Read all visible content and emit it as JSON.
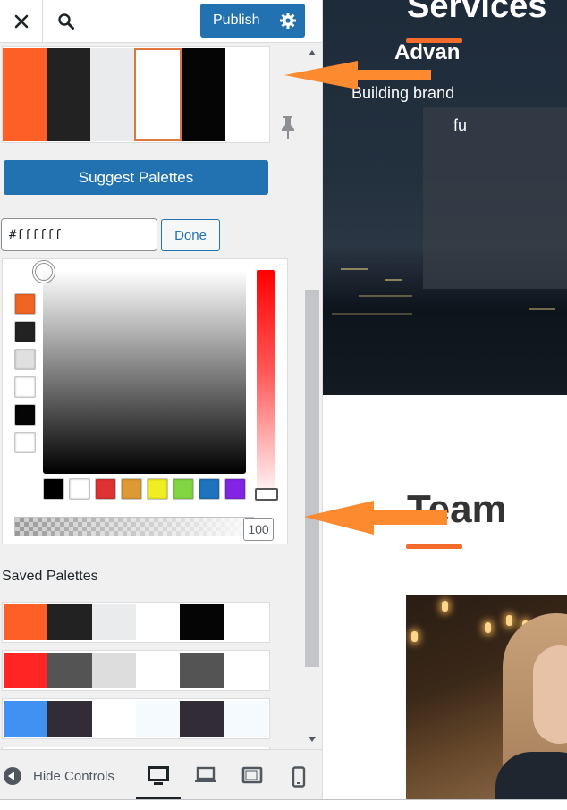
{
  "topbar": {
    "close_icon": "close-icon",
    "search_icon": "search-icon",
    "publish_label": "Publish",
    "publish_settings_icon": "gear-icon"
  },
  "palette": {
    "colors": [
      "#fd5f27",
      "#222222",
      "#eaebed",
      "#ffffff",
      "#050505",
      "#ffffff"
    ],
    "selected_index": 3
  },
  "suggest_label": "Suggest Palettes",
  "color_picker": {
    "hex_value": "#ffffff",
    "done_label": "Done",
    "side_swatches": [
      "#f06424",
      "#222222",
      "#e0e0e0",
      "#ffffff",
      "#050505",
      "#ffffff"
    ],
    "bottom_swatches": [
      "#000000",
      "#ffffff",
      "#dd3333",
      "#dd9933",
      "#eeee22",
      "#81d742",
      "#1e73be",
      "#8224e3"
    ],
    "alpha_value": "100",
    "alpha_percent": 100
  },
  "saved": {
    "heading": "Saved Palettes",
    "palettes": [
      [
        "#fd5f27",
        "#222222",
        "#eaebed",
        "#ffffff",
        "#050505",
        "#ffffff"
      ],
      [
        "#ff2525",
        "#545454",
        "#dddddd",
        "#ffffff",
        "#545454",
        "#ffffff"
      ],
      [
        "#4191f3",
        "#312c36",
        "#ffffff",
        "#f5faff",
        "#312c36",
        "#f5faff"
      ],
      [
        "#ff4040",
        "#222222",
        "#eaebed",
        "#ffffff",
        "#050505",
        "#ffffff"
      ]
    ]
  },
  "footer": {
    "hide_controls_label": "Hide Controls",
    "devices": [
      "desktop-icon",
      "laptop-icon",
      "tablet-icon",
      "mobile-icon"
    ]
  },
  "preview": {
    "services_title": "Services",
    "card_heading": "Advan",
    "card_line1": "Building brand",
    "card_line2": "fu",
    "team_title": "Team",
    "accent_color": "#f36c2c"
  }
}
